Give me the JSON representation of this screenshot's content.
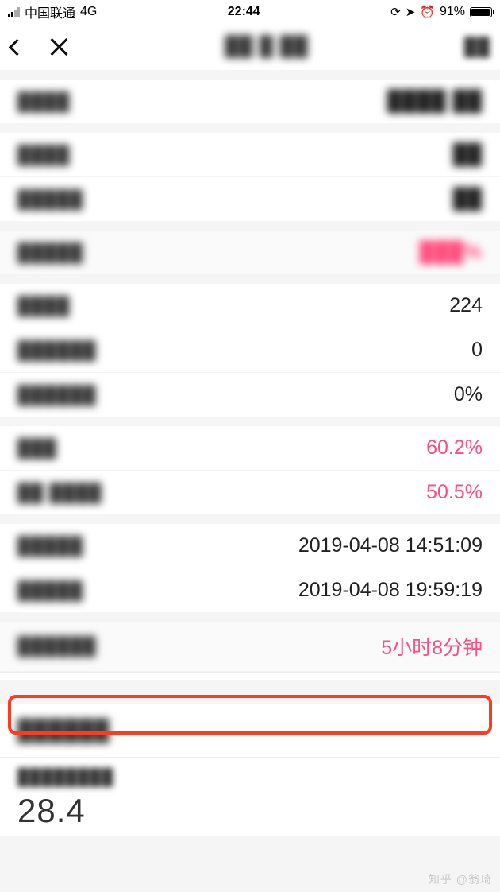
{
  "status": {
    "carrier": "中国联通",
    "network": "4G",
    "time": "22:44",
    "battery_pct": "91%"
  },
  "nav": {
    "title_masked": "██ █ ██",
    "action_masked": "██"
  },
  "sections": {
    "s1": {
      "r1": {
        "label": "████",
        "value": "████ ██"
      }
    },
    "s2": {
      "r1": {
        "label": "████",
        "value": "██"
      },
      "r2": {
        "label": "█████",
        "value": "██"
      }
    },
    "s3": {
      "r1": {
        "label": "█████",
        "value": "███%"
      }
    },
    "s4": {
      "r1": {
        "label": "████",
        "value": "224"
      },
      "r2": {
        "label": "██████",
        "value": "0"
      },
      "r3": {
        "label": "██████",
        "value": "0%"
      }
    },
    "s5": {
      "r1": {
        "label": "███",
        "value": "60.2%"
      },
      "r2": {
        "label": "██ ████",
        "value": "50.5%"
      }
    },
    "s6": {
      "r1": {
        "label": "█████",
        "value": "2019-04-08 14:51:09"
      },
      "r2": {
        "label": "█████",
        "value": "2019-04-08 19:59:19"
      }
    },
    "s7": {
      "r1": {
        "label": "██████",
        "value": "5小时8分钟"
      }
    }
  },
  "footer": {
    "heading_masked": "██████",
    "sublabel_masked": "████████",
    "big_value": "28.4"
  },
  "watermark": "知乎 @翁琦"
}
